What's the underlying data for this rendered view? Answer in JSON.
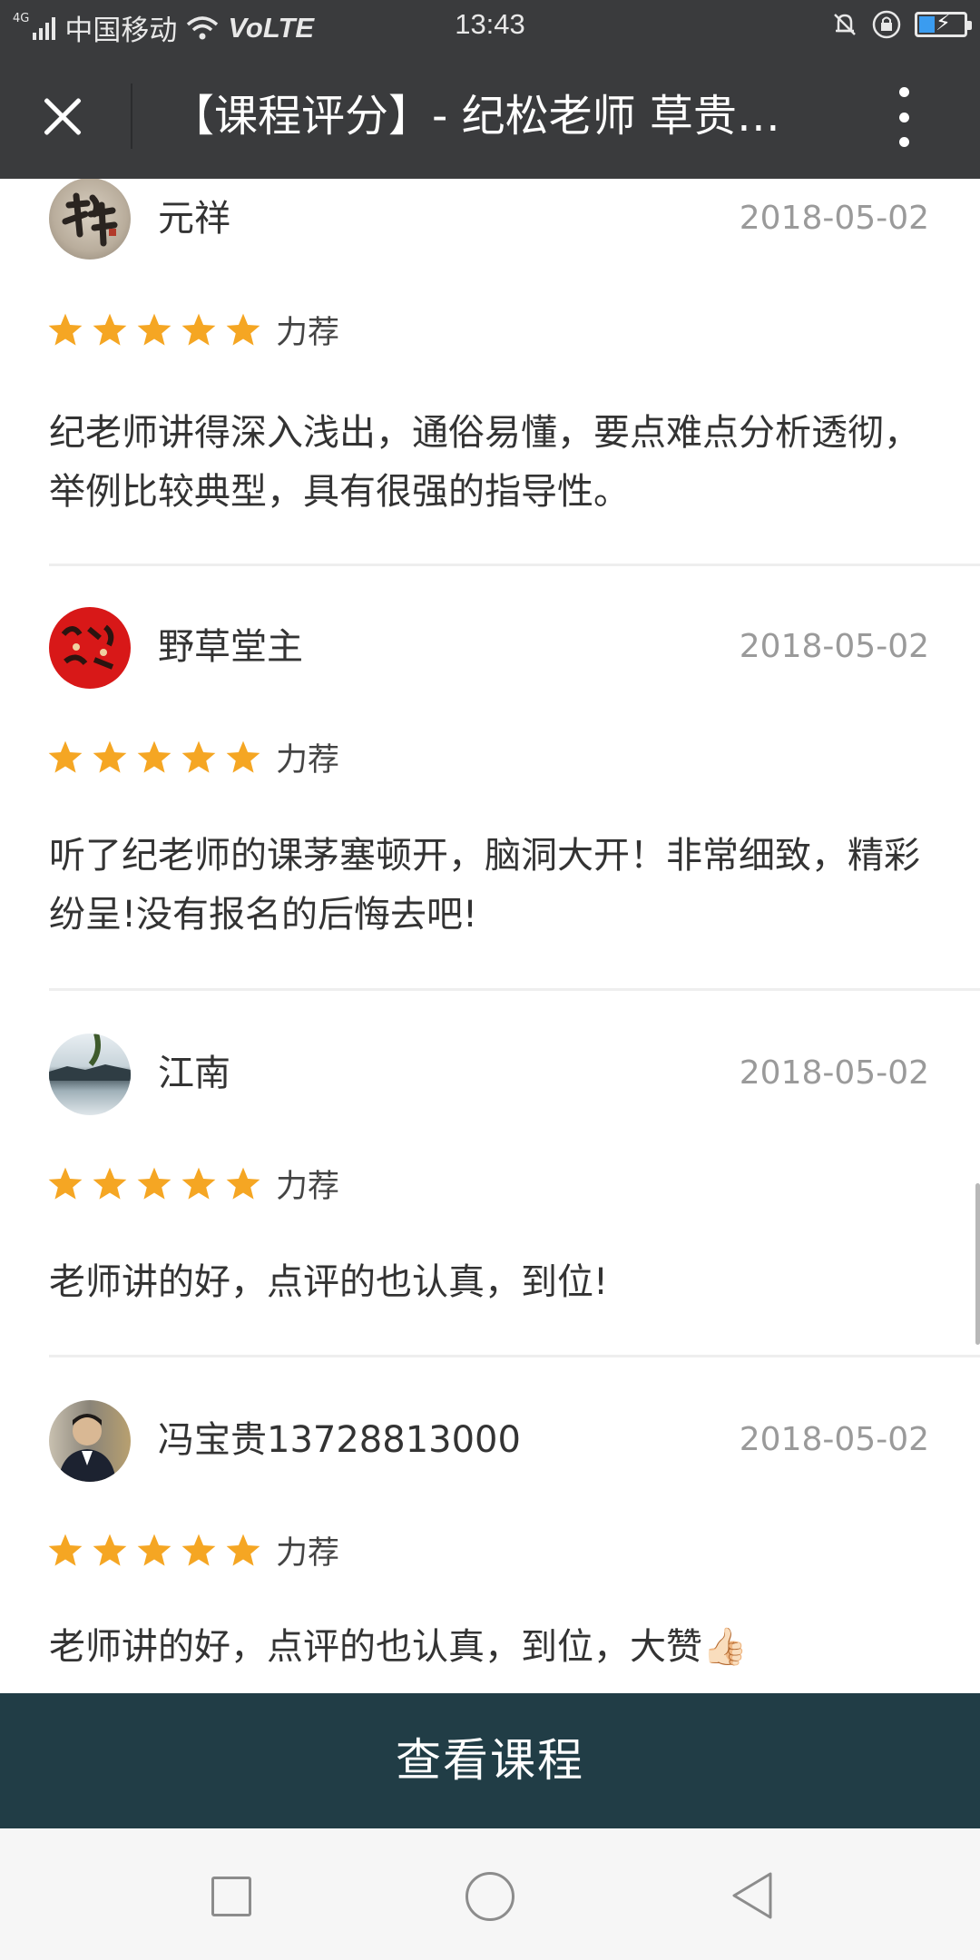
{
  "status_bar": {
    "network_type": "4G",
    "carrier": "中国移动",
    "volte": "VoLTE",
    "time": "13:43",
    "icons": [
      "signal-icon",
      "wifi-icon",
      "mute-icon",
      "rotation-lock-icon",
      "battery-charging-icon"
    ],
    "battery_level_fraction": 0.35
  },
  "title_bar": {
    "title": "【课程评分】- 纪松老师 草贵…",
    "close_icon": "close-icon",
    "more_icon": "more-vertical-icon"
  },
  "reviews": [
    {
      "user": "元祥",
      "date": "2018-05-02",
      "rating": 5,
      "rating_label": "力荐",
      "text": "纪老师讲得深入浅出，通俗易懂，要点难点分析透彻，举例比较典型，具有很强的指导性。",
      "avatar": "calligraphy-avatar"
    },
    {
      "user": "野草堂主",
      "date": "2018-05-02",
      "rating": 5,
      "rating_label": "力荐",
      "text": "听了纪老师的课茅塞顿开，脑洞大开！非常细致，精彩纷呈!没有报名的后悔去吧!",
      "avatar": "red-papercut-avatar"
    },
    {
      "user": "江南",
      "date": "2018-05-02",
      "rating": 5,
      "rating_label": "力荐",
      "text": "老师讲的好，点评的也认真，到位!",
      "avatar": "landscape-avatar"
    },
    {
      "user": "冯宝贵13728813000",
      "date": "2018-05-02",
      "rating": 5,
      "rating_label": "力荐",
      "text": "老师讲的好，点评的也认真，到位，大赞",
      "emoji": "👍🏻",
      "avatar": "portrait-avatar"
    }
  ],
  "cta": {
    "label": "查看课程"
  },
  "nav_bar": {
    "icons": [
      "recent-apps-icon",
      "home-icon",
      "back-icon"
    ]
  },
  "colors": {
    "title_bar_bg": "#3a3b3d",
    "star": "#f5a623",
    "cta_bg": "#213d46",
    "date_text": "#9a9a9a"
  }
}
